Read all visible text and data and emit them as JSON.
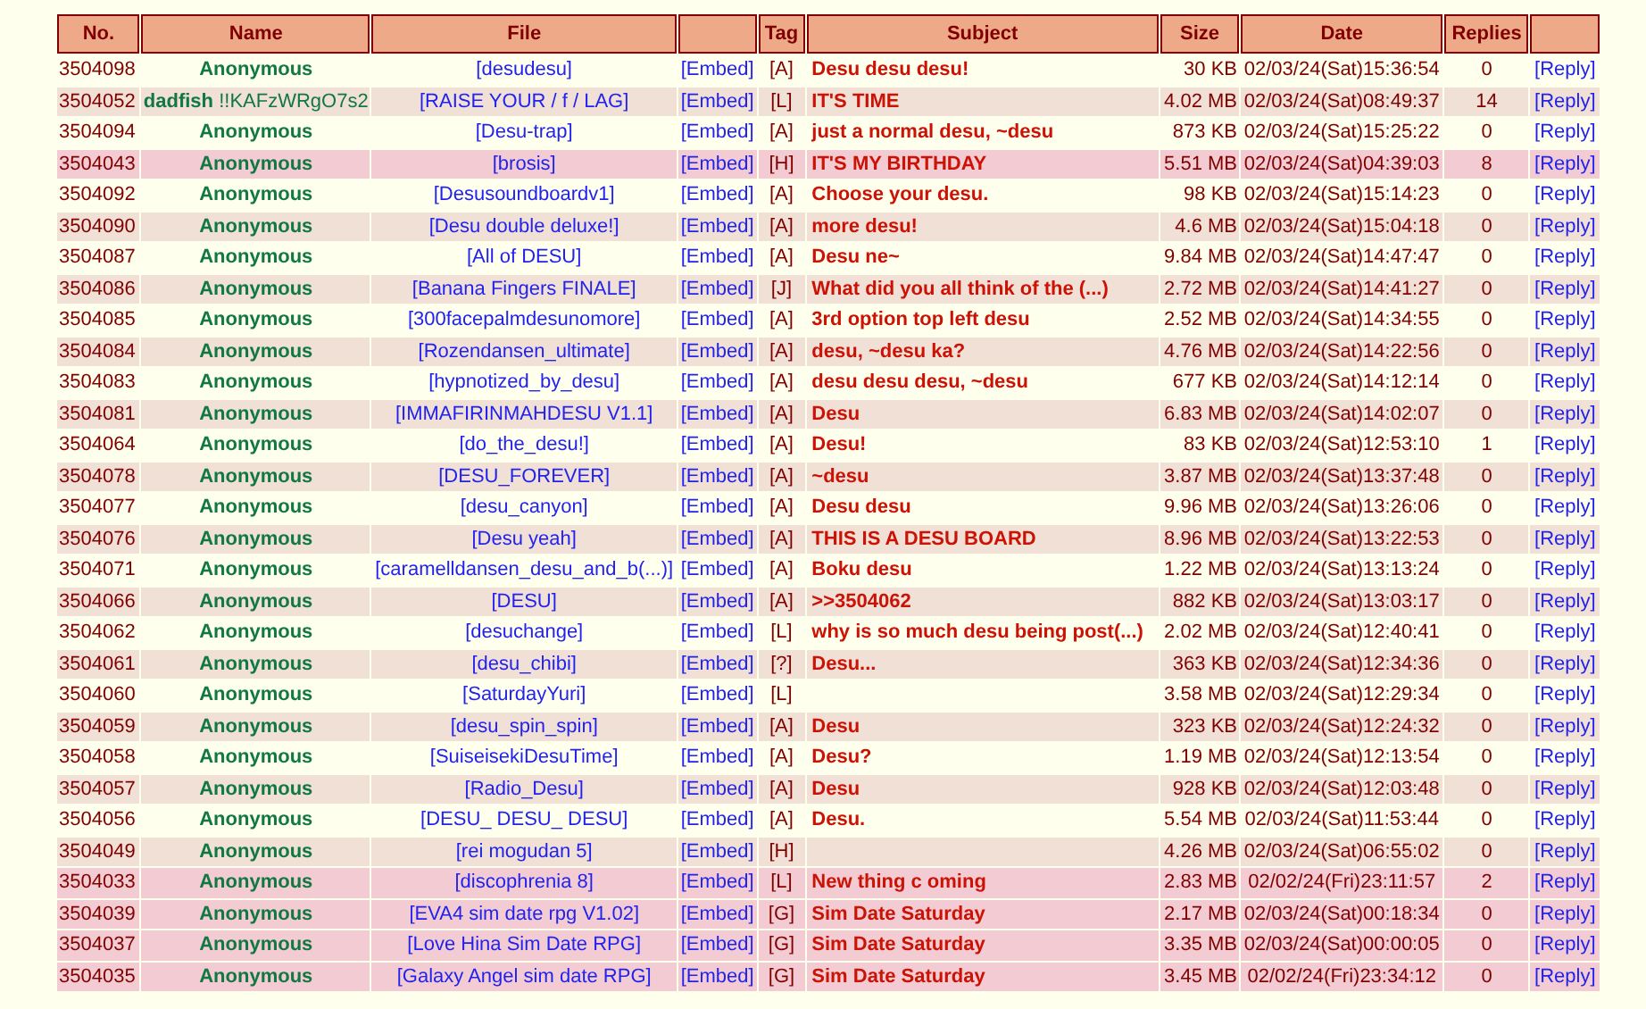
{
  "columns": [
    {
      "kind": "text",
      "label": "No."
    },
    {
      "kind": "text",
      "label": "Name"
    },
    {
      "kind": "text",
      "label": "File"
    },
    {
      "kind": "blank"
    },
    {
      "kind": "text",
      "label": "Tag"
    },
    {
      "kind": "text",
      "label": "Subject"
    },
    {
      "kind": "text",
      "label": "Size"
    },
    {
      "kind": "text",
      "label": "Date"
    },
    {
      "kind": "text",
      "label": "Replies"
    },
    {
      "kind": "blank"
    }
  ],
  "rows": [
    {
      "no": "3504098",
      "name": "Anonymous",
      "file": "[desudesu]",
      "embed": "[Embed]",
      "tag": "[A]",
      "subject": "Desu desu desu!",
      "size": "30 KB",
      "date": "02/03/24(Sat)15:36:54",
      "replies": "0",
      "reply": "[Reply]",
      "highlighted": false
    },
    {
      "no": "3504052",
      "name": "dadfish",
      "tripcode": "!!KAFzWRgO7s2",
      "file": "[RAISE YOUR / f / LAG]",
      "embed": "[Embed]",
      "tag": "[L]",
      "subject": "IT'S TIME",
      "size": "4.02 MB",
      "date": "02/03/24(Sat)08:49:37",
      "replies": "14",
      "reply": "[Reply]",
      "highlighted": false
    },
    {
      "no": "3504094",
      "name": "Anonymous",
      "file": "[Desu-trap]",
      "embed": "[Embed]",
      "tag": "[A]",
      "subject": "just a normal desu, ~desu",
      "size": "873 KB",
      "date": "02/03/24(Sat)15:25:22",
      "replies": "0",
      "reply": "[Reply]",
      "highlighted": false
    },
    {
      "no": "3504043",
      "name": "Anonymous",
      "file": "[brosis]",
      "embed": "[Embed]",
      "tag": "[H]",
      "subject": "IT'S MY BIRTHDAY",
      "size": "5.51 MB",
      "date": "02/03/24(Sat)04:39:03",
      "replies": "8",
      "reply": "[Reply]",
      "highlighted": true
    },
    {
      "no": "3504092",
      "name": "Anonymous",
      "file": "[Desusoundboardv1]",
      "embed": "[Embed]",
      "tag": "[A]",
      "subject": "Choose your desu.",
      "size": "98 KB",
      "date": "02/03/24(Sat)15:14:23",
      "replies": "0",
      "reply": "[Reply]",
      "highlighted": false
    },
    {
      "no": "3504090",
      "name": "Anonymous",
      "file": "[Desu double deluxe!]",
      "embed": "[Embed]",
      "tag": "[A]",
      "subject": "more desu!",
      "size": "4.6 MB",
      "date": "02/03/24(Sat)15:04:18",
      "replies": "0",
      "reply": "[Reply]",
      "highlighted": false
    },
    {
      "no": "3504087",
      "name": "Anonymous",
      "file": "[All of DESU]",
      "embed": "[Embed]",
      "tag": "[A]",
      "subject": "Desu ne~",
      "size": "9.84 MB",
      "date": "02/03/24(Sat)14:47:47",
      "replies": "0",
      "reply": "[Reply]",
      "highlighted": false
    },
    {
      "no": "3504086",
      "name": "Anonymous",
      "file": "[Banana Fingers FINALE]",
      "embed": "[Embed]",
      "tag": "[J]",
      "subject": "What did you all think of the (...)",
      "size": "2.72 MB",
      "date": "02/03/24(Sat)14:41:27",
      "replies": "0",
      "reply": "[Reply]",
      "highlighted": false
    },
    {
      "no": "3504085",
      "name": "Anonymous",
      "file": "[300facepalmdesunomore]",
      "embed": "[Embed]",
      "tag": "[A]",
      "subject": "3rd option top left desu",
      "size": "2.52 MB",
      "date": "02/03/24(Sat)14:34:55",
      "replies": "0",
      "reply": "[Reply]",
      "highlighted": false
    },
    {
      "no": "3504084",
      "name": "Anonymous",
      "file": "[Rozendansen_ultimate]",
      "embed": "[Embed]",
      "tag": "[A]",
      "subject": "desu, ~desu ka?",
      "size": "4.76 MB",
      "date": "02/03/24(Sat)14:22:56",
      "replies": "0",
      "reply": "[Reply]",
      "highlighted": false
    },
    {
      "no": "3504083",
      "name": "Anonymous",
      "file": "[hypnotized_by_desu]",
      "embed": "[Embed]",
      "tag": "[A]",
      "subject": "desu desu desu, ~desu",
      "size": "677 KB",
      "date": "02/03/24(Sat)14:12:14",
      "replies": "0",
      "reply": "[Reply]",
      "highlighted": false
    },
    {
      "no": "3504081",
      "name": "Anonymous",
      "file": "[IMMAFIRINMAHDESU V1.1]",
      "embed": "[Embed]",
      "tag": "[A]",
      "subject": "Desu",
      "size": "6.83 MB",
      "date": "02/03/24(Sat)14:02:07",
      "replies": "0",
      "reply": "[Reply]",
      "highlighted": false
    },
    {
      "no": "3504064",
      "name": "Anonymous",
      "file": "[do_the_desu!]",
      "embed": "[Embed]",
      "tag": "[A]",
      "subject": "Desu!",
      "size": "83 KB",
      "date": "02/03/24(Sat)12:53:10",
      "replies": "1",
      "reply": "[Reply]",
      "highlighted": false
    },
    {
      "no": "3504078",
      "name": "Anonymous",
      "file": "[DESU_FOREVER]",
      "embed": "[Embed]",
      "tag": "[A]",
      "subject": "~desu",
      "size": "3.87 MB",
      "date": "02/03/24(Sat)13:37:48",
      "replies": "0",
      "reply": "[Reply]",
      "highlighted": false
    },
    {
      "no": "3504077",
      "name": "Anonymous",
      "file": "[desu_canyon]",
      "embed": "[Embed]",
      "tag": "[A]",
      "subject": "Desu desu",
      "size": "9.96 MB",
      "date": "02/03/24(Sat)13:26:06",
      "replies": "0",
      "reply": "[Reply]",
      "highlighted": false
    },
    {
      "no": "3504076",
      "name": "Anonymous",
      "file": "[Desu yeah]",
      "embed": "[Embed]",
      "tag": "[A]",
      "subject": "THIS IS A DESU BOARD",
      "size": "8.96 MB",
      "date": "02/03/24(Sat)13:22:53",
      "replies": "0",
      "reply": "[Reply]",
      "highlighted": false
    },
    {
      "no": "3504071",
      "name": "Anonymous",
      "file": "[caramelldansen_desu_and_b(...)]",
      "embed": "[Embed]",
      "tag": "[A]",
      "subject": "Boku desu",
      "size": "1.22 MB",
      "date": "02/03/24(Sat)13:13:24",
      "replies": "0",
      "reply": "[Reply]",
      "highlighted": false
    },
    {
      "no": "3504066",
      "name": "Anonymous",
      "file": "[DESU]",
      "embed": "[Embed]",
      "tag": "[A]",
      "subject": ">>3504062",
      "size": "882 KB",
      "date": "02/03/24(Sat)13:03:17",
      "replies": "0",
      "reply": "[Reply]",
      "highlighted": false
    },
    {
      "no": "3504062",
      "name": "Anonymous",
      "file": "[desuchange]",
      "embed": "[Embed]",
      "tag": "[L]",
      "subject": "why is so much desu being post(...)",
      "size": "2.02 MB",
      "date": "02/03/24(Sat)12:40:41",
      "replies": "0",
      "reply": "[Reply]",
      "highlighted": false
    },
    {
      "no": "3504061",
      "name": "Anonymous",
      "file": "[desu_chibi]",
      "embed": "[Embed]",
      "tag": "[?]",
      "subject": "Desu...",
      "size": "363 KB",
      "date": "02/03/24(Sat)12:34:36",
      "replies": "0",
      "reply": "[Reply]",
      "highlighted": false
    },
    {
      "no": "3504060",
      "name": "Anonymous",
      "file": "[SaturdayYuri]",
      "embed": "[Embed]",
      "tag": "[L]",
      "size": "3.58 MB",
      "date": "02/03/24(Sat)12:29:34",
      "replies": "0",
      "reply": "[Reply]",
      "highlighted": false
    },
    {
      "no": "3504059",
      "name": "Anonymous",
      "file": "[desu_spin_spin]",
      "embed": "[Embed]",
      "tag": "[A]",
      "subject": "Desu",
      "size": "323 KB",
      "date": "02/03/24(Sat)12:24:32",
      "replies": "0",
      "reply": "[Reply]",
      "highlighted": false
    },
    {
      "no": "3504058",
      "name": "Anonymous",
      "file": "[SuiseisekiDesuTime]",
      "embed": "[Embed]",
      "tag": "[A]",
      "subject": "Desu?",
      "size": "1.19 MB",
      "date": "02/03/24(Sat)12:13:54",
      "replies": "0",
      "reply": "[Reply]",
      "highlighted": false
    },
    {
      "no": "3504057",
      "name": "Anonymous",
      "file": "[Radio_Desu]",
      "embed": "[Embed]",
      "tag": "[A]",
      "subject": "Desu",
      "size": "928 KB",
      "date": "02/03/24(Sat)12:03:48",
      "replies": "0",
      "reply": "[Reply]",
      "highlighted": false
    },
    {
      "no": "3504056",
      "name": "Anonymous",
      "file": "[DESU_ DESU_ DESU]",
      "embed": "[Embed]",
      "tag": "[A]",
      "subject": "Desu.",
      "size": "5.54 MB",
      "date": "02/03/24(Sat)11:53:44",
      "replies": "0",
      "reply": "[Reply]",
      "highlighted": false
    },
    {
      "no": "3504049",
      "name": "Anonymous",
      "file": "[rei mogudan 5]",
      "embed": "[Embed]",
      "tag": "[H]",
      "size": "4.26 MB",
      "date": "02/03/24(Sat)06:55:02",
      "replies": "0",
      "reply": "[Reply]",
      "highlighted": false
    },
    {
      "no": "3504033",
      "name": "Anonymous",
      "file": "[discophrenia 8]",
      "embed": "[Embed]",
      "tag": "[L]",
      "subject": "New thing c oming",
      "size": "2.83 MB",
      "date": "02/02/24(Fri)23:11:57",
      "replies": "2",
      "reply": "[Reply]",
      "highlighted": true
    },
    {
      "no": "3504039",
      "name": "Anonymous",
      "file": "[EVA4 sim date rpg V1.02]",
      "embed": "[Embed]",
      "tag": "[G]",
      "subject": "Sim Date Saturday",
      "size": "2.17 MB",
      "date": "02/03/24(Sat)00:18:34",
      "replies": "0",
      "reply": "[Reply]",
      "highlighted": true
    },
    {
      "no": "3504037",
      "name": "Anonymous",
      "file": "[Love Hina Sim Date RPG]",
      "embed": "[Embed]",
      "tag": "[G]",
      "subject": "Sim Date Saturday",
      "size": "3.35 MB",
      "date": "02/03/24(Sat)00:00:05",
      "replies": "0",
      "reply": "[Reply]",
      "highlighted": true
    },
    {
      "no": "3504035",
      "name": "Anonymous",
      "file": "[Galaxy Angel sim date RPG]",
      "embed": "[Embed]",
      "tag": "[G]",
      "subject": "Sim Date Saturday",
      "size": "3.45 MB",
      "date": "02/02/24(Fri)23:34:12",
      "replies": "0",
      "reply": "[Reply]",
      "highlighted": true
    }
  ]
}
